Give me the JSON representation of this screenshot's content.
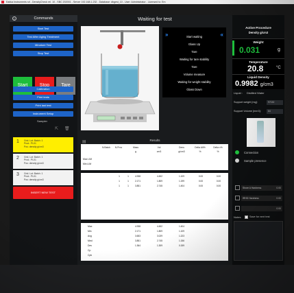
{
  "titlebar": {
    "text": "Eabka Instruments srl - DensityCheck rel. 10 - SBC 202001 - Server 192.168.1.232 - Database: dbgest_10 - User: Administrator - Licensed to: Em"
  },
  "left": {
    "header": "Commands",
    "buttons": [
      "Start Test",
      "Test After Aging Treatment",
      "Minature Test",
      "Stop Test"
    ],
    "start": "Start",
    "stop": "Stop",
    "tare": "Tare",
    "buttons2": [
      "Calibration",
      "Print tests",
      "Print last test",
      "Instrument Setup"
    ],
    "sampler_label": "Sampler",
    "batches": [
      {
        "num": "1",
        "lines": [
          "Grid. Lot: Batch: 1",
          "Prod.: PL01",
          "Pos: density g/cm3"
        ],
        "color": "#ffee00"
      },
      {
        "num": "2",
        "lines": [
          "Grid. Lot: Batch: 1",
          "Prod.: PL01",
          "Pos: density g/cm3"
        ],
        "color": "#f2f2f2"
      },
      {
        "num": "3",
        "lines": [
          "Grid. Lot: Batch: 1",
          "Prod.: PL01",
          "Pos: density g/cm3"
        ],
        "color": "#f2f2f2"
      }
    ],
    "insert_btn": "INSERT NEW TEST"
  },
  "main": {
    "title": "Waiting for test",
    "steps": [
      "Start waiting",
      "Glass Up",
      "Tare",
      "Waiting for tare stability",
      "Tare",
      "Volume measure",
      "Waiting for weight stability",
      "Glass Down"
    ],
    "results_label": "Results",
    "headers": [
      "N.Batch",
      "N.Prov",
      "Mass",
      "Vol",
      "Dens",
      "Delta Alt%",
      "Delta x%"
    ],
    "units": [
      "",
      "",
      "g",
      "cm3",
      "g/cm3",
      "%",
      "%"
    ],
    "limit_rows": [
      "Max LIM",
      "Min LIM"
    ],
    "rows": [
      [
        "1",
        "1",
        "4.938",
        "4.452",
        "1.109",
        "0.00",
        "0.00"
      ],
      [
        "1",
        "1",
        "2.171",
        "1.809",
        "1.199",
        "0.00",
        "0.00"
      ],
      [
        "1",
        "1",
        "3.851",
        "2.745",
        "1.404",
        "0.00",
        "0.00"
      ]
    ],
    "stats_labels": [
      "Max",
      "Min",
      "Avg",
      "Med",
      "Dev",
      "Cp",
      "Cpk"
    ],
    "stats": [
      [
        "4.938",
        "4.452",
        "1.404"
      ],
      [
        "2.171",
        "1.809",
        "1.109"
      ],
      [
        "3.653",
        "3.029",
        "1.223"
      ],
      [
        "3.851",
        "2.745",
        "1.156"
      ],
      [
        "1.364",
        "1.309",
        "0.159"
      ],
      [
        "",
        "",
        ""
      ],
      [
        "",
        "",
        ""
      ]
    ]
  },
  "right": {
    "header": "Active Procedure",
    "procedure": "Density g/cm3",
    "weight_label": "Weight",
    "weight_value": "0.031",
    "weight_unit": "g",
    "temp_label": "Temperature",
    "temp_value": "20.8",
    "temp_unit": "°C",
    "ld_label": "Liquid Density",
    "ld_value": "0.9982",
    "ld_unit": "g/cm3",
    "liquid_label": "Liquid :",
    "liquid_value": "Distilled Water",
    "support_weight_label": "Support weight  [mg]:",
    "support_weight_value": "97152",
    "support_volume_label": "Support Volume  [mm3]:",
    "support_volume_value": "64",
    "connection_label": "Connection",
    "sample_label": "Sample presence",
    "hardness": [
      {
        "label": "Shore A Hardness",
        "value": "0.00"
      },
      {
        "label": "IRHD Hardness",
        "value": "0.00"
      },
      {
        "label": "",
        "value": "0.00"
      }
    ],
    "notes_label": "Notes",
    "save_label": "Save for next test"
  },
  "colors": {
    "blue": "#1e64c8",
    "green": "#1ebe3c",
    "red": "#e81c1c",
    "grey": "#7a7d80",
    "yellow": "#ffee00"
  }
}
